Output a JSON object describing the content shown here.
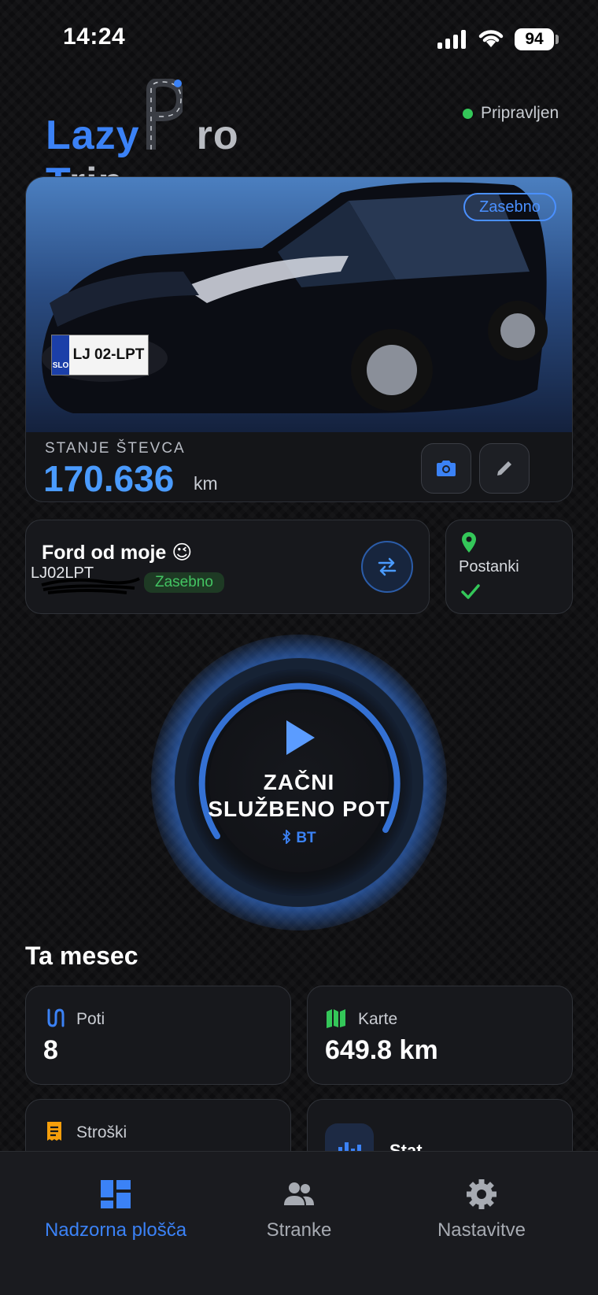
{
  "status_bar": {
    "time": "14:24",
    "battery": "94"
  },
  "header": {
    "logo_parts": [
      "Lazy",
      "P",
      "ro",
      "T",
      "rip"
    ],
    "status": "Pripravljen",
    "status_color": "#34c759"
  },
  "car_card": {
    "tag": "Zasebno",
    "plate_country": "SLO",
    "plate_number": "LJ 02-LPT",
    "odometer_label": "STANJE ŠTEVCA",
    "odometer_value": "170.636",
    "odometer_unit": "km",
    "buttons": [
      "camera-icon",
      "pencil-icon"
    ]
  },
  "vehicle": {
    "name": "Ford od  moje 😉",
    "plate": "LJ02LPT",
    "badge": "Zasebno"
  },
  "stops": {
    "label": "Postanki"
  },
  "start": {
    "line1": "ZAČNI",
    "line2": "SLUŽBENO POT",
    "bt": "BT"
  },
  "month": {
    "title": "Ta mesec",
    "stats": [
      {
        "label": "Poti",
        "value": "8",
        "icon": "route-icon",
        "color": "#3b82f6"
      },
      {
        "label": "Karte",
        "value": "649.8 km",
        "icon": "map-icon",
        "color": "#34c759"
      },
      {
        "label": "Stroški",
        "value": "",
        "icon": "receipt-icon",
        "color": "#f59e0b"
      },
      {
        "label": "Stat",
        "value": "",
        "icon": "chart-icon",
        "color": "#3b82f6"
      }
    ]
  },
  "tabbar": {
    "tabs": [
      {
        "label": "Nadzorna plošča",
        "active": true
      },
      {
        "label": "Stranke",
        "active": false
      },
      {
        "label": "Nastavitve",
        "active": false
      }
    ],
    "accent": "#3b82f6"
  }
}
